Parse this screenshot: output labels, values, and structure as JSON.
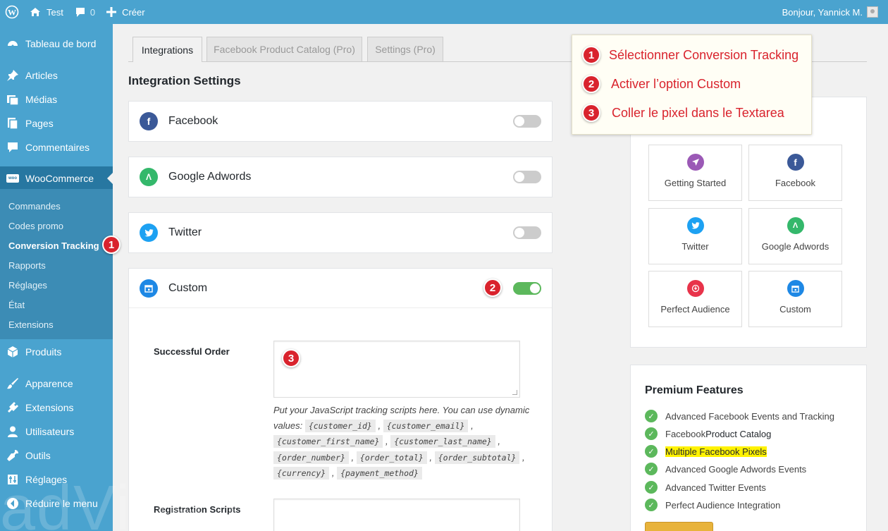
{
  "adminbar": {
    "site": "Test",
    "comments": "0",
    "create": "Créer",
    "greeting": "Bonjour, Yannick M."
  },
  "sidebar": {
    "items": [
      {
        "label": "Tableau de bord",
        "icon": "dashboard-icon"
      },
      {
        "label": "Articles",
        "icon": "pin-icon"
      },
      {
        "label": "Médias",
        "icon": "media-icon"
      },
      {
        "label": "Pages",
        "icon": "pages-icon"
      },
      {
        "label": "Commentaires",
        "icon": "comment-icon"
      },
      {
        "label": "WooCommerce",
        "icon": "woo-icon"
      },
      {
        "label": "Produits",
        "icon": "box-icon"
      },
      {
        "label": "Apparence",
        "icon": "brush-icon"
      },
      {
        "label": "Extensions",
        "icon": "plugin-icon"
      },
      {
        "label": "Utilisateurs",
        "icon": "user-icon"
      },
      {
        "label": "Outils",
        "icon": "wrench-icon"
      },
      {
        "label": "Réglages",
        "icon": "settings-icon"
      },
      {
        "label": "Réduire le menu",
        "icon": "collapse-icon"
      }
    ],
    "woo_badge": "woo",
    "submenu": [
      "Commandes",
      "Codes promo",
      "Conversion Tracking",
      "Rapports",
      "Réglages",
      "État",
      "Extensions"
    ]
  },
  "tabs": [
    "Integrations",
    "Facebook Product Catalog (Pro)",
    "Settings (Pro)"
  ],
  "section_title": "Integration Settings",
  "integrations": [
    {
      "label": "Facebook",
      "enabled": false
    },
    {
      "label": "Google Adwords",
      "enabled": false
    },
    {
      "label": "Twitter",
      "enabled": false
    },
    {
      "label": "Custom",
      "enabled": true
    }
  ],
  "custom": {
    "successful_order_label": "Successful Order",
    "help_text": "Put your JavaScript tracking scripts here. You can use dynamic values:",
    "dynamic_values": [
      "{customer_id}",
      "{customer_email}",
      "{customer_first_name}",
      "{customer_last_name}",
      "{order_number}",
      "{order_total}",
      "{order_subtotal}",
      "{currency}",
      "{payment_method}"
    ],
    "registration_label": "Registration Scripts"
  },
  "callout": {
    "steps": [
      {
        "num": "1",
        "text": "Sélectionner Conversion Tracking"
      },
      {
        "num": "2",
        "text": "Activer l’option Custom"
      },
      {
        "num": "3",
        "text": "Coller le pixel dans le Textarea"
      }
    ]
  },
  "badges": {
    "one": "1",
    "two": "2",
    "three": "3"
  },
  "integration_grid": [
    "Getting Started",
    "Facebook",
    "Twitter",
    "Google Adwords",
    "Perfect Audience",
    "Custom"
  ],
  "premium": {
    "title": "Premium Features",
    "features": [
      {
        "before": "Advanced Facebook Events and Tracking",
        "bold": "",
        "after": "",
        "highlight": false
      },
      {
        "before": "Facebook ",
        "bold": "Product Catalog",
        "after": "",
        "highlight": false
      },
      {
        "before": "",
        "bold": "Multiple ",
        "after": "Facebook Pixels",
        "highlight": true
      },
      {
        "before": "Advanced Google Adwords Events",
        "bold": "",
        "after": "",
        "highlight": false
      },
      {
        "before": "Advanced Twitter Events",
        "bold": "",
        "after": "",
        "highlight": false
      },
      {
        "before": "Perfect Audience Integration",
        "bold": "",
        "after": "",
        "highlight": false
      }
    ]
  },
  "watermark": "adVibe.fr",
  "colors": {
    "sidebar": "#4aa3cf",
    "sidebar_current": "#2777a1",
    "accent_red": "#d9232d",
    "toggle_on": "#5cb85c",
    "facebook": "#3b5998",
    "adwords": "#34b86b",
    "twitter": "#1da1f2",
    "custom": "#1e88e5",
    "getting_started": "#9b59b6",
    "perfect_audience": "#e8334a"
  }
}
